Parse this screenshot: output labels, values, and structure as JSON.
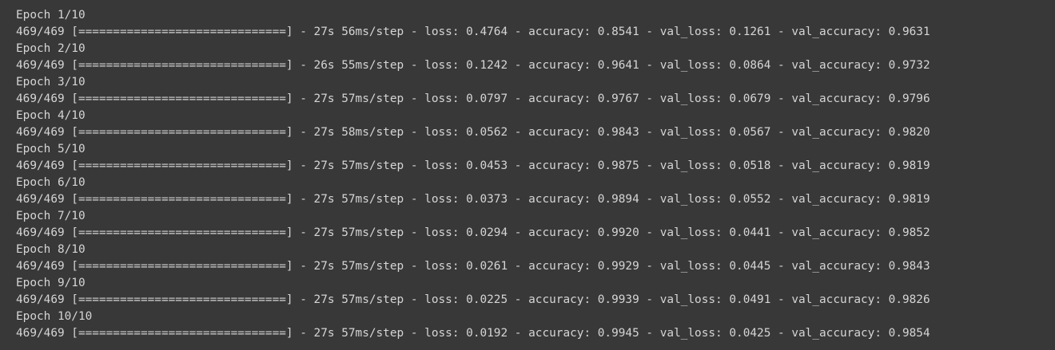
{
  "output": {
    "epochs": [
      {
        "header": "Epoch 1/10",
        "progress": "469/469 [==============================] - 27s 56ms/step - loss: 0.4764 - accuracy: 0.8541 - val_loss: 0.1261 - val_accuracy: 0.9631"
      },
      {
        "header": "Epoch 2/10",
        "progress": "469/469 [==============================] - 26s 55ms/step - loss: 0.1242 - accuracy: 0.9641 - val_loss: 0.0864 - val_accuracy: 0.9732"
      },
      {
        "header": "Epoch 3/10",
        "progress": "469/469 [==============================] - 27s 57ms/step - loss: 0.0797 - accuracy: 0.9767 - val_loss: 0.0679 - val_accuracy: 0.9796"
      },
      {
        "header": "Epoch 4/10",
        "progress": "469/469 [==============================] - 27s 58ms/step - loss: 0.0562 - accuracy: 0.9843 - val_loss: 0.0567 - val_accuracy: 0.9820"
      },
      {
        "header": "Epoch 5/10",
        "progress": "469/469 [==============================] - 27s 57ms/step - loss: 0.0453 - accuracy: 0.9875 - val_loss: 0.0518 - val_accuracy: 0.9819"
      },
      {
        "header": "Epoch 6/10",
        "progress": "469/469 [==============================] - 27s 57ms/step - loss: 0.0373 - accuracy: 0.9894 - val_loss: 0.0552 - val_accuracy: 0.9819"
      },
      {
        "header": "Epoch 7/10",
        "progress": "469/469 [==============================] - 27s 57ms/step - loss: 0.0294 - accuracy: 0.9920 - val_loss: 0.0441 - val_accuracy: 0.9852"
      },
      {
        "header": "Epoch 8/10",
        "progress": "469/469 [==============================] - 27s 57ms/step - loss: 0.0261 - accuracy: 0.9929 - val_loss: 0.0445 - val_accuracy: 0.9843"
      },
      {
        "header": "Epoch 9/10",
        "progress": "469/469 [==============================] - 27s 57ms/step - loss: 0.0225 - accuracy: 0.9939 - val_loss: 0.0491 - val_accuracy: 0.9826"
      },
      {
        "header": "Epoch 10/10",
        "progress": "469/469 [==============================] - 27s 57ms/step - loss: 0.0192 - accuracy: 0.9945 - val_loss: 0.0425 - val_accuracy: 0.9854"
      }
    ]
  },
  "colors": {
    "background": "#383838",
    "text": "#d5d5d5"
  }
}
